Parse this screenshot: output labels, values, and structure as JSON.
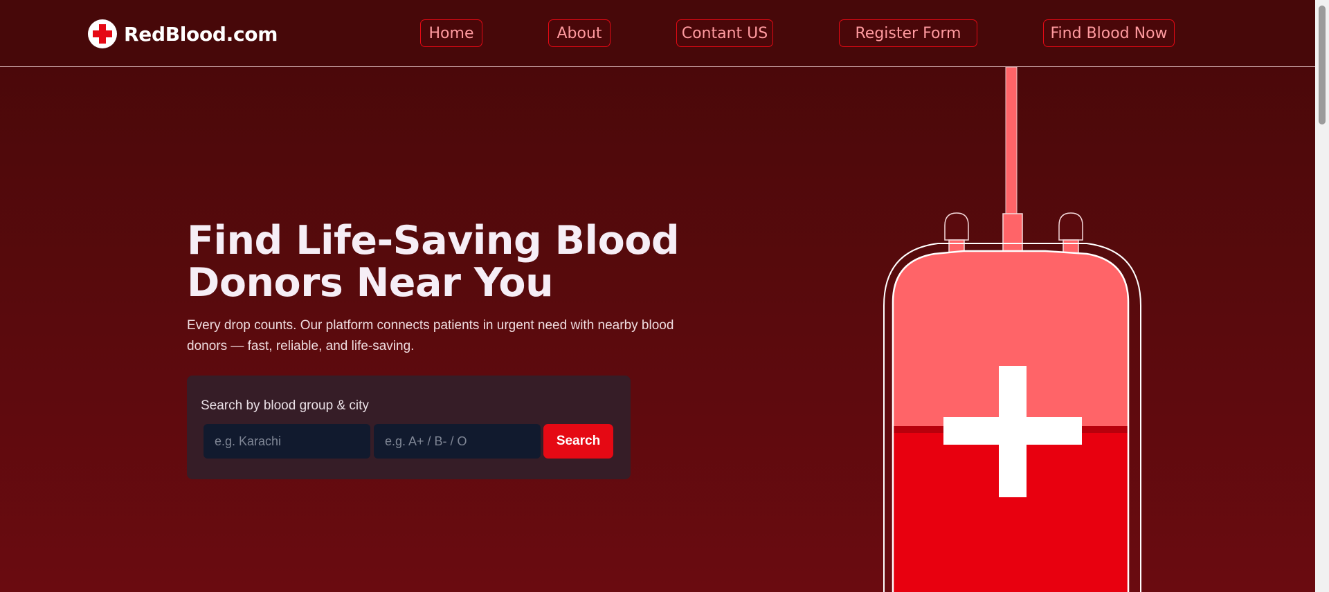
{
  "brand": {
    "name": "RedBlood.com",
    "logo_icon": "red-cross-icon"
  },
  "nav": {
    "items": [
      {
        "label": "Home"
      },
      {
        "label": "About"
      },
      {
        "label": "Contant US"
      },
      {
        "label": "Register Form"
      },
      {
        "label": "Find Blood Now"
      }
    ]
  },
  "hero": {
    "title": "Find Life-Saving Blood Donors Near You",
    "subtitle": "Every drop counts. Our platform connects patients in urgent need with nearby blood donors — fast, reliable, and life-saving."
  },
  "search": {
    "label": "Search by blood group & city",
    "city_value": "",
    "city_placeholder": "e.g. Karachi",
    "group_value": "",
    "group_placeholder": "e.g. A+ / B- / O",
    "button_label": "Search"
  },
  "illustration": {
    "icon": "blood-bag-icon",
    "fill_fraction": 0.48
  },
  "colors": {
    "accent": "#e50914",
    "background": "#4d080b",
    "bag_light": "#ff6468",
    "bag_dark": "#e8000f",
    "nav_text": "#ff9a9f"
  }
}
